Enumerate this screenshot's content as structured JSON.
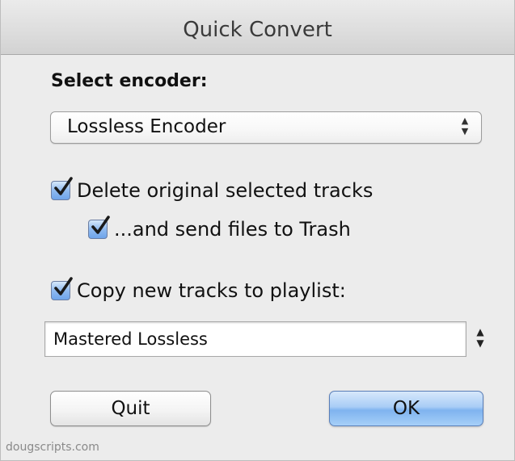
{
  "window": {
    "title": "Quick Convert"
  },
  "encoder": {
    "label": "Select encoder:",
    "selected": "Lossless Encoder",
    "arrows_icon": "updown-arrows-icon"
  },
  "options": {
    "delete_original": {
      "label": "Delete original selected tracks",
      "checked": true
    },
    "send_to_trash": {
      "label": "...and send files to Trash",
      "checked": true
    },
    "copy_to_playlist": {
      "label": "Copy new tracks to playlist:",
      "checked": true
    }
  },
  "playlist": {
    "value": "Mastered Lossless",
    "stepper_icon": "updown-arrows-icon"
  },
  "buttons": {
    "quit": "Quit",
    "ok": "OK"
  },
  "footer": {
    "credit": "dougscripts.com"
  },
  "colors": {
    "window_bg": "#ececec",
    "checkbox_accent": "#6ea4ea",
    "default_button": "#a9cdf6"
  }
}
